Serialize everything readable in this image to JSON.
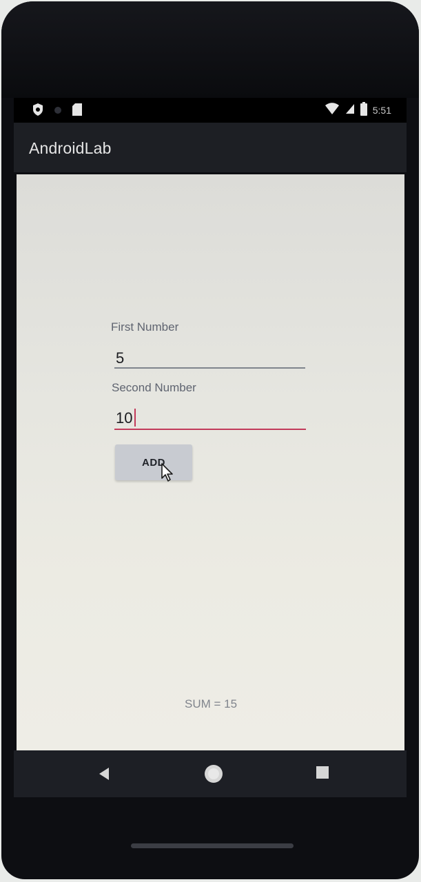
{
  "status_bar": {
    "time": "5:51",
    "icons": [
      "shield-icon",
      "dot-icon",
      "sd-card-icon",
      "wifi-icon",
      "signal-icon",
      "battery-icon"
    ]
  },
  "app_bar": {
    "title": "AndroidLab"
  },
  "form": {
    "first_label": "First Number",
    "first_value": "5",
    "second_label": "Second Number",
    "second_value": "10",
    "add_label": "ADD",
    "result": "SUM = 15"
  },
  "nav": {
    "icons": [
      "back-icon",
      "home-icon",
      "recents-icon"
    ]
  },
  "colors": {
    "app_bar": "#1d1f24",
    "focus_underline": "#c2395a",
    "button": "#c8cbd1"
  }
}
